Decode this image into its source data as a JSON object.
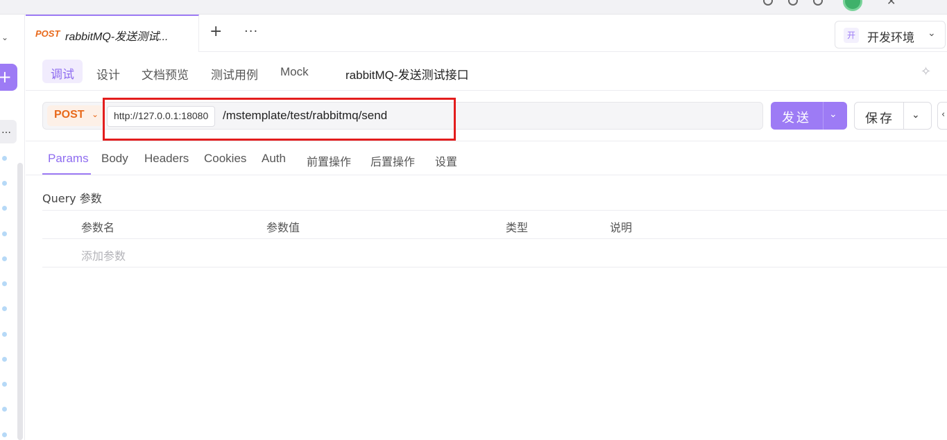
{
  "tab": {
    "method": "POST",
    "name": "rabbitMQ-发送测试...",
    "new_tab": "+",
    "more": "···"
  },
  "environment": {
    "badge": "开",
    "name": "开发环境"
  },
  "subnav": {
    "items": [
      "调试",
      "设计",
      "文档预览",
      "测试用例",
      "Mock"
    ],
    "api_title": "rabbitMQ-发送测试接口"
  },
  "request": {
    "method": "POST",
    "base_url": "http://127.0.0.1:18080",
    "path": "/mstemplate/test/rabbitmq/send"
  },
  "actions": {
    "send": "发送",
    "save": "保存"
  },
  "param_tabs": [
    "Params",
    "Body",
    "Headers",
    "Cookies",
    "Auth",
    "前置操作",
    "后置操作",
    "设置"
  ],
  "query": {
    "title": "Query 参数",
    "columns": [
      "参数名",
      "参数值",
      "类型",
      "说明"
    ],
    "add_placeholder": "添加参数"
  },
  "colors": {
    "accent": "#9d7bf5",
    "method_post": "#e8691b",
    "highlight": "#e31d1d"
  }
}
